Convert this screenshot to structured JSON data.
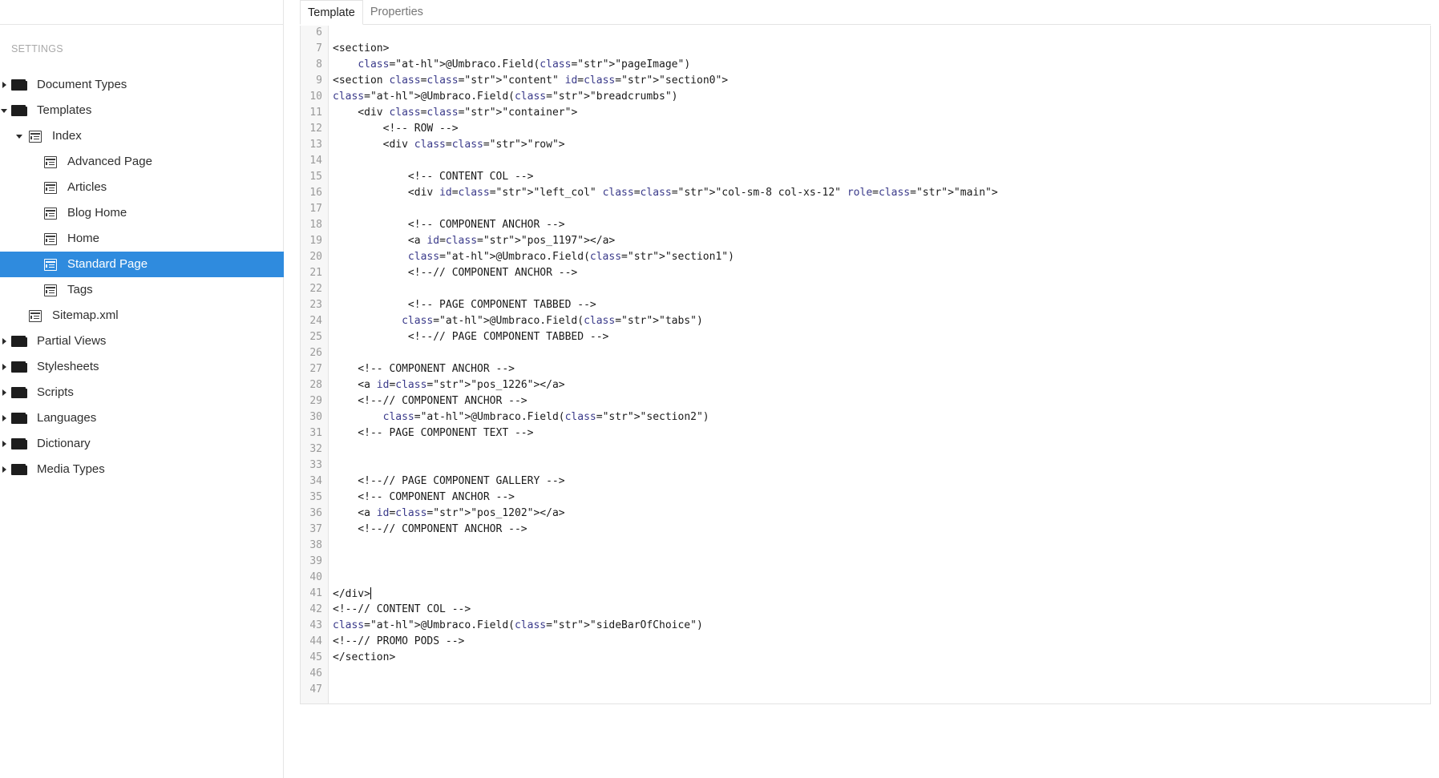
{
  "tabs": [
    {
      "label": "Template",
      "active": true
    },
    {
      "label": "Properties",
      "active": false
    }
  ],
  "sidebar": {
    "heading": "SETTINGS",
    "items": [
      {
        "label": "Document Types",
        "level": 0,
        "icon": "folder-icon",
        "arrow": "right",
        "selected": false
      },
      {
        "label": "Templates",
        "level": 0,
        "icon": "folder-icon",
        "arrow": "down",
        "selected": false
      },
      {
        "label": "Index",
        "level": 1,
        "icon": "template-icon",
        "arrow": "down",
        "selected": false
      },
      {
        "label": "Advanced Page",
        "level": 2,
        "icon": "template-icon",
        "arrow": "",
        "selected": false
      },
      {
        "label": "Articles",
        "level": 2,
        "icon": "template-icon",
        "arrow": "",
        "selected": false
      },
      {
        "label": "Blog Home",
        "level": 2,
        "icon": "template-icon",
        "arrow": "",
        "selected": false
      },
      {
        "label": "Home",
        "level": 2,
        "icon": "template-icon",
        "arrow": "",
        "selected": false
      },
      {
        "label": "Standard Page",
        "level": 2,
        "icon": "template-icon",
        "arrow": "",
        "selected": true
      },
      {
        "label": "Tags",
        "level": 2,
        "icon": "template-icon",
        "arrow": "",
        "selected": false
      },
      {
        "label": "Sitemap.xml",
        "level": 1,
        "icon": "template-icon",
        "arrow": "",
        "selected": false
      },
      {
        "label": "Partial Views",
        "level": 0,
        "icon": "folder-icon",
        "arrow": "right",
        "selected": false
      },
      {
        "label": "Stylesheets",
        "level": 0,
        "icon": "folder-icon",
        "arrow": "right",
        "selected": false
      },
      {
        "label": "Scripts",
        "level": 0,
        "icon": "folder-icon",
        "arrow": "right",
        "selected": false
      },
      {
        "label": "Languages",
        "level": 0,
        "icon": "folder-icon",
        "arrow": "right",
        "selected": false
      },
      {
        "label": "Dictionary",
        "level": 0,
        "icon": "folder-icon",
        "arrow": "right",
        "selected": false
      },
      {
        "label": "Media Types",
        "level": 0,
        "icon": "folder-icon",
        "arrow": "right",
        "selected": false
      }
    ]
  },
  "editor": {
    "lines": [
      {
        "num": "6",
        "text": ""
      },
      {
        "num": "7",
        "text": "<section>"
      },
      {
        "num": "8",
        "text": "    @Umbraco.Field(\"pageImage\")"
      },
      {
        "num": "9",
        "text": "<section class=\"content\" id=\"section0\">"
      },
      {
        "num": "10",
        "text": "@Umbraco.Field(\"breadcrumbs\")"
      },
      {
        "num": "11",
        "text": "    <div class=\"container\">"
      },
      {
        "num": "12",
        "text": "        <!-- ROW -->"
      },
      {
        "num": "13",
        "text": "        <div class=\"row\">"
      },
      {
        "num": "14",
        "text": ""
      },
      {
        "num": "15",
        "text": "            <!-- CONTENT COL -->"
      },
      {
        "num": "16",
        "text": "            <div id=\"left_col\" class=\"col-sm-8 col-xs-12\" role=\"main\">"
      },
      {
        "num": "17",
        "text": ""
      },
      {
        "num": "18",
        "text": "            <!-- COMPONENT ANCHOR -->"
      },
      {
        "num": "19",
        "text": "            <a id=\"pos_1197\"></a>"
      },
      {
        "num": "20",
        "text": "            @Umbraco.Field(\"section1\")"
      },
      {
        "num": "21",
        "text": "            <!--// COMPONENT ANCHOR -->"
      },
      {
        "num": "22",
        "text": ""
      },
      {
        "num": "23",
        "text": "            <!-- PAGE COMPONENT TABBED -->"
      },
      {
        "num": "24",
        "text": "           @Umbraco.Field(\"tabs\")"
      },
      {
        "num": "25",
        "text": "            <!--// PAGE COMPONENT TABBED -->"
      },
      {
        "num": "26",
        "text": ""
      },
      {
        "num": "27",
        "text": "    <!-- COMPONENT ANCHOR -->"
      },
      {
        "num": "28",
        "text": "    <a id=\"pos_1226\"></a>"
      },
      {
        "num": "29",
        "text": "    <!--// COMPONENT ANCHOR -->"
      },
      {
        "num": "30",
        "text": "        @Umbraco.Field(\"section2\")"
      },
      {
        "num": "31",
        "text": "    <!-- PAGE COMPONENT TEXT -->"
      },
      {
        "num": "32",
        "text": ""
      },
      {
        "num": "33",
        "text": ""
      },
      {
        "num": "34",
        "text": "    <!--// PAGE COMPONENT GALLERY -->"
      },
      {
        "num": "35",
        "text": "    <!-- COMPONENT ANCHOR -->"
      },
      {
        "num": "36",
        "text": "    <a id=\"pos_1202\"></a>"
      },
      {
        "num": "37",
        "text": "    <!--// COMPONENT ANCHOR -->"
      },
      {
        "num": "38",
        "text": ""
      },
      {
        "num": "39",
        "text": ""
      },
      {
        "num": "40",
        "text": ""
      },
      {
        "num": "41",
        "text": "</div>"
      },
      {
        "num": "42",
        "text": "<!--// CONTENT COL -->"
      },
      {
        "num": "43",
        "text": "@Umbraco.Field(\"sideBarOfChoice\")"
      },
      {
        "num": "44",
        "text": "<!--// PROMO PODS -->"
      },
      {
        "num": "45",
        "text": "</section>"
      },
      {
        "num": "46",
        "text": ""
      },
      {
        "num": "47",
        "text": ""
      }
    ]
  },
  "colors": {
    "selected_bg": "#2f8bde",
    "at_highlight": "#f7f56a"
  }
}
